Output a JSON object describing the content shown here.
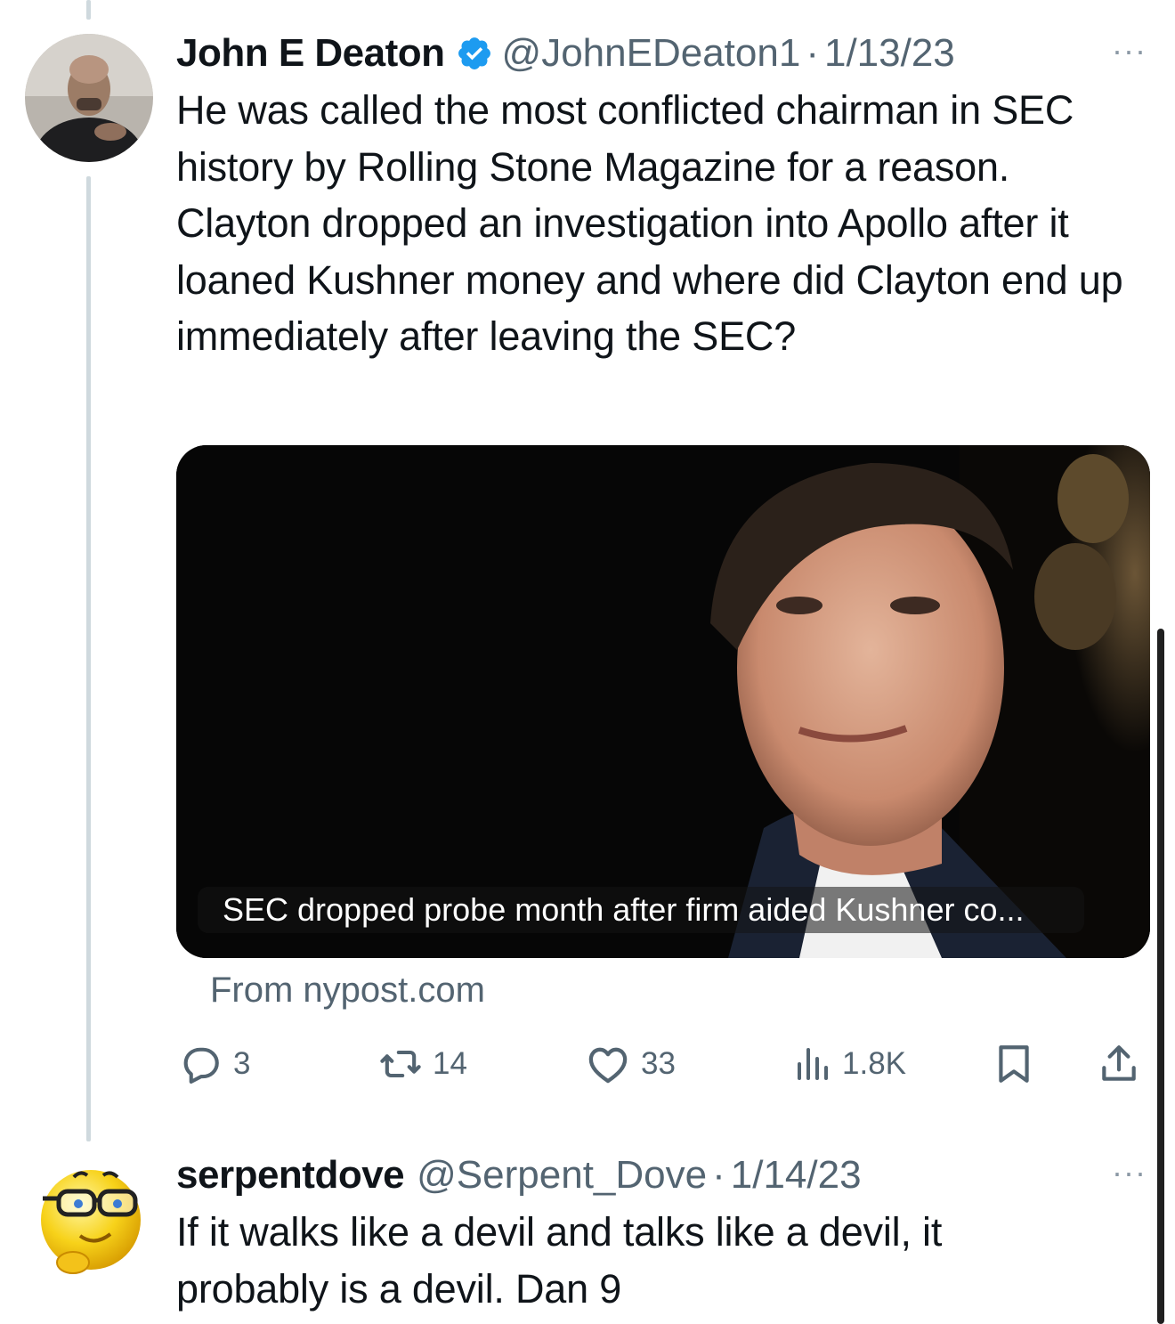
{
  "tweet1": {
    "display_name": "John E Deaton",
    "handle": "@JohnEDeaton1",
    "separator": "·",
    "date": "1/13/23",
    "more": "···",
    "text": "He was called the most conflicted chairman in SEC history by Rolling Stone Magazine for a reason. Clayton dropped an investigation into Apollo after it loaned Kushner money and where did Clayton end up immediately after leaving the SEC?",
    "media_caption": "SEC dropped probe month after firm aided Kushner co...",
    "source": "From nypost.com",
    "actions": {
      "replies": "3",
      "retweets": "14",
      "likes": "33",
      "views": "1.8K"
    }
  },
  "tweet2": {
    "display_name": "serpentdove",
    "handle": "@Serpent_Dove",
    "separator": "·",
    "date": "1/14/23",
    "more": "···",
    "text": "If it walks like a devil and talks like a devil, it probably is a devil. Dan 9"
  },
  "colors": {
    "verified_blue": "#1d9bf0",
    "secondary_text": "#536471",
    "thread_line": "#cfd9de"
  },
  "icons": [
    "verified-badge-icon",
    "more-icon",
    "reply-icon",
    "retweet-icon",
    "like-icon",
    "views-icon",
    "bookmark-icon",
    "share-icon"
  ]
}
